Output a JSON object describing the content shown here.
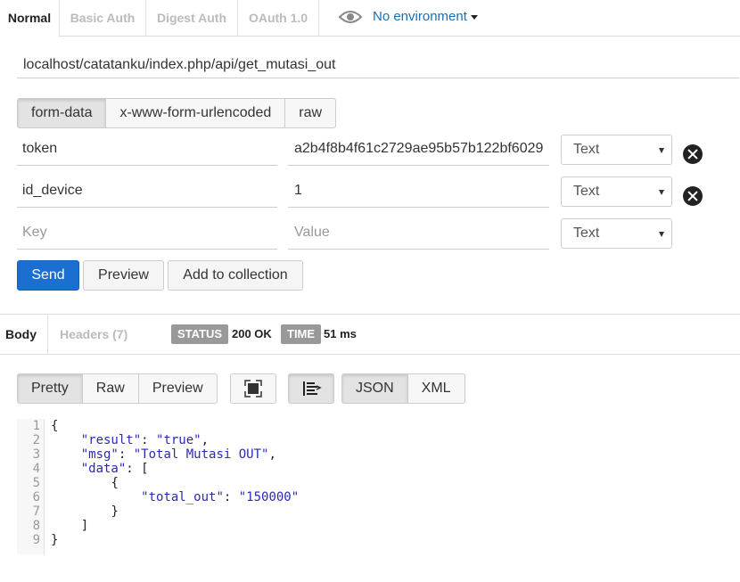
{
  "auth_tabs": [
    "Normal",
    "Basic Auth",
    "Digest Auth",
    "OAuth 1.0"
  ],
  "environment": {
    "label": "No environment"
  },
  "url": "localhost/catatanku/index.php/api/get_mutasi_out",
  "body_types": [
    "form-data",
    "x-www-form-urlencoded",
    "raw"
  ],
  "params": [
    {
      "key": "token",
      "value": "a2b4f8b4f61c2729ae95b57b122bf6029",
      "type": "Text"
    },
    {
      "key": "id_device",
      "value": "1",
      "type": "Text"
    }
  ],
  "new_param": {
    "key_placeholder": "Key",
    "value_placeholder": "Value",
    "type": "Text"
  },
  "actions": {
    "send": "Send",
    "preview": "Preview",
    "add": "Add to collection"
  },
  "response": {
    "tabs": {
      "body": "Body",
      "headers": "Headers (7)"
    },
    "status_label": "STATUS",
    "status_value": "200 OK",
    "time_label": "TIME",
    "time_value": "51 ms",
    "view_modes": [
      "Pretty",
      "Raw",
      "Preview"
    ],
    "formats": [
      "JSON",
      "XML"
    ],
    "line_numbers": [
      "1",
      "2",
      "3",
      "4",
      "5",
      "6",
      "7",
      "8",
      "9"
    ],
    "code": {
      "l1": "{",
      "l2_key": "\"result\"",
      "l2_val": "\"true\"",
      "l3_key": "\"msg\"",
      "l3_val": "\"Total Mutasi OUT\"",
      "l4_key": "\"data\"",
      "l4_rest": "[",
      "l5": "{",
      "l6_key": "\"total_out\"",
      "l6_val": "\"150000\"",
      "l7": "}",
      "l8": "]",
      "l9": "}"
    }
  },
  "icons": {
    "eye": "eye-icon",
    "delete": "remove-circle-icon",
    "fullscreen": "fullscreen-icon",
    "wrap": "text-wrap-icon"
  }
}
